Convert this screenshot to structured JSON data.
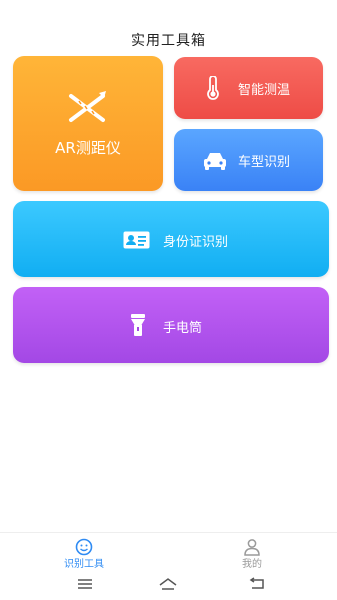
{
  "page": {
    "title": "实用工具箱"
  },
  "tools": {
    "ar_ruler": {
      "label": "AR测距仪",
      "icon": "ruler-pencil-icon"
    },
    "thermometer": {
      "label": "智能测温",
      "icon": "thermometer-icon"
    },
    "car_recognition": {
      "label": "车型识别",
      "icon": "car-icon"
    },
    "id_recognition": {
      "label": "身份证识别",
      "icon": "id-card-icon"
    },
    "flashlight": {
      "label": "手电筒",
      "icon": "flashlight-icon"
    }
  },
  "tabs": [
    {
      "label": "识别工具",
      "icon": "scan-face-icon",
      "active": true
    },
    {
      "label": "我的",
      "icon": "user-icon",
      "active": false
    }
  ],
  "nav": {
    "buttons": [
      "menu-icon",
      "home-icon",
      "back-icon"
    ]
  },
  "colors": {
    "ar_card": "#fb9925",
    "thermometer_card": "#ee4c46",
    "car_card": "#3a82f6",
    "id_card": "#11aef2",
    "flashlight_card": "#a348e5",
    "tab_active": "#2f8bf3",
    "tab_inactive": "#9a9a9a"
  }
}
